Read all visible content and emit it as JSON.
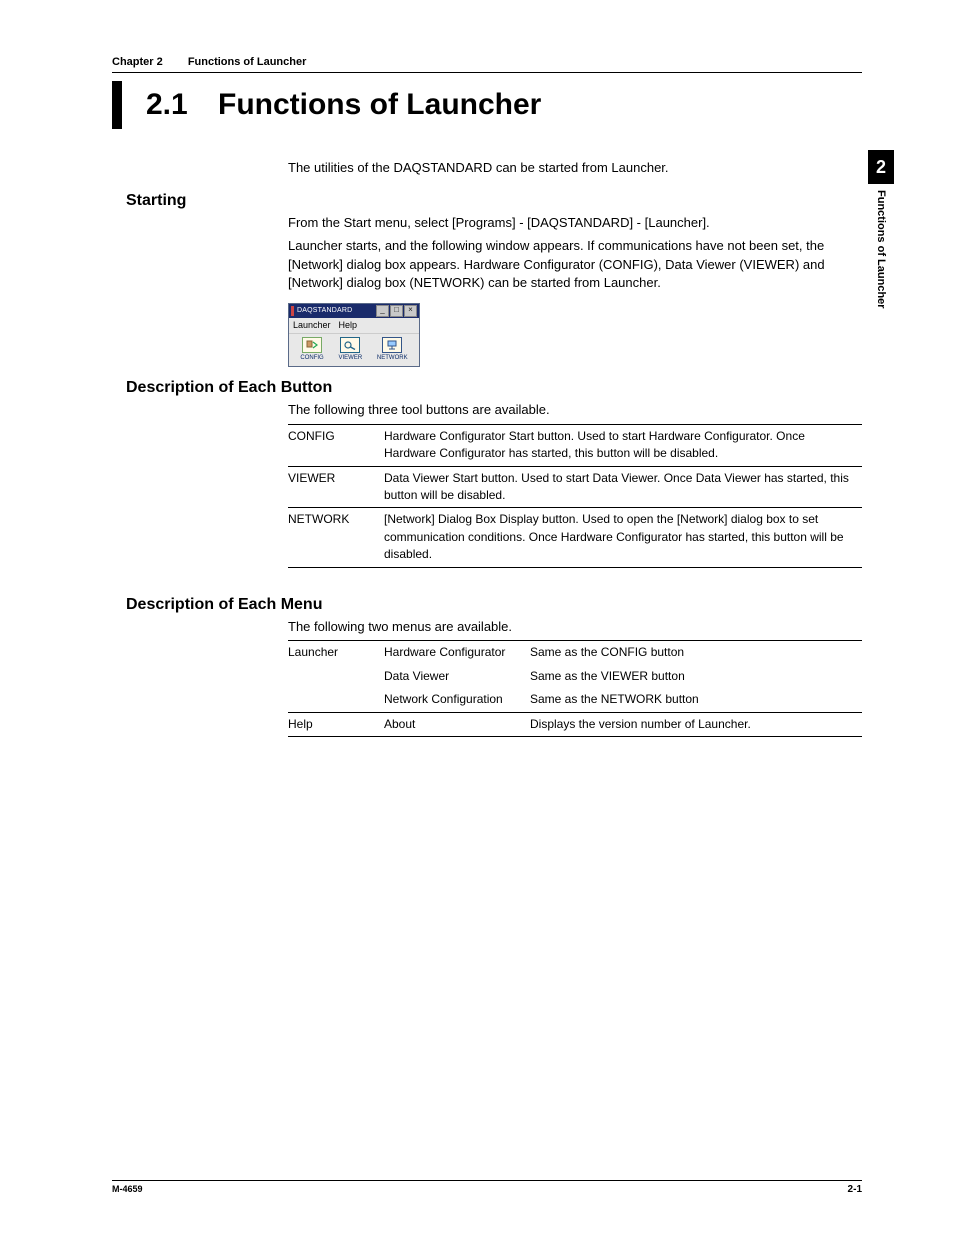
{
  "running_head": {
    "chapter": "Chapter 2",
    "title": "Functions of Launcher"
  },
  "section": {
    "number": "2.1",
    "title": "Functions of Launcher"
  },
  "intro": "The utilities of the DAQSTANDARD can be started from Launcher.",
  "starting": {
    "heading": "Starting",
    "p1": "From the Start menu, select [Programs] - [DAQSTANDARD] - [Launcher].",
    "p2": "Launcher starts, and the following window appears.  If communications have not been set, the [Network] dialog box appears.  Hardware Configurator (CONFIG), Data Viewer (VIEWER) and [Network] dialog box (NETWORK) can be started from Launcher."
  },
  "app_window": {
    "title": "DAQSTANDARD",
    "menus": [
      "Launcher",
      "Help"
    ],
    "tools": [
      "CONFIG",
      "VIEWER",
      "NETWORK"
    ]
  },
  "buttons": {
    "heading": "Description of Each Button",
    "lead": "The following three tool buttons are available.",
    "rows": [
      {
        "name": "CONFIG",
        "desc": "Hardware Configurator Start button.  Used to start Hardware Configurator.  Once Hardware Configurator has started, this button will be disabled."
      },
      {
        "name": "VIEWER",
        "desc": "Data Viewer Start button.  Used to start Data Viewer.  Once Data Viewer has started, this button will be disabled."
      },
      {
        "name": "NETWORK",
        "desc": "[Network] Dialog Box Display button.  Used to open the [Network] dialog box to set communication conditions.  Once Hardware Configurator has started, this button will be disabled."
      }
    ]
  },
  "menus": {
    "heading": "Description of Each Menu",
    "lead": "The following two menus are available.",
    "rows": [
      {
        "menu": "Launcher",
        "item": "Hardware Configurator",
        "desc": "Same as the CONFIG button"
      },
      {
        "menu": "",
        "item": "Data Viewer",
        "desc": "Same as the VIEWER button"
      },
      {
        "menu": "",
        "item": "Network Configuration",
        "desc": "Same as the NETWORK button"
      },
      {
        "menu": "Help",
        "item": "About",
        "desc": "Displays the version number of Launcher."
      }
    ]
  },
  "side_tab": {
    "number": "2",
    "label": "Functions of Launcher"
  },
  "footer": {
    "left": "M-4659",
    "right": "2-1"
  }
}
